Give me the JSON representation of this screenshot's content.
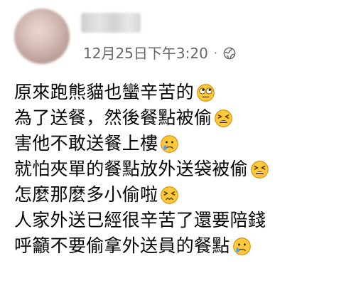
{
  "post": {
    "author_name": "",
    "timestamp": "12月25日下午3:20",
    "separator": "·",
    "audience_icon": "globe-icon",
    "lines": [
      {
        "text": "原來跑熊貓也蠻辛苦的",
        "emoji": "face-with-rolling-eyes"
      },
      {
        "text": "為了送餐，然後餐點被偷",
        "emoji": "tired-face"
      },
      {
        "text": "害他不敢送餐上樓",
        "emoji": "sad-face-with-tear"
      },
      {
        "text": "就怕夾單的餐點放外送袋被偷",
        "emoji": "tired-face"
      },
      {
        "text": "怎麼那麼多小偷啦",
        "emoji": "persevering-face"
      },
      {
        "text": "人家外送已經很辛苦了還要陪錢",
        "emoji": ""
      },
      {
        "text": "呼籲不要偷拿外送員的餐點",
        "emoji": "sad-face-with-tear"
      }
    ]
  },
  "colors": {
    "text": "#050505",
    "meta": "#65676b",
    "emoji_face": "#ffc93a",
    "emoji_outline": "#d68a00"
  }
}
